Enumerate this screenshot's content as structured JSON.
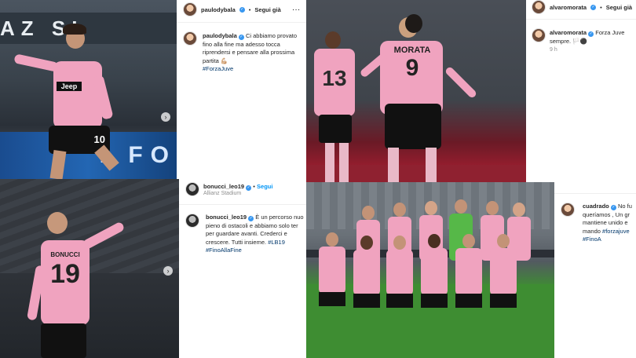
{
  "posts": [
    {
      "username": "paulodybala",
      "follow_label": "Segui già",
      "caption": "Ci abbiamo provato fino alla fine ma adesso tocca riprendersi e pensare alla prossima partita 💪🏼",
      "hashtag": "#ForzaJuve",
      "photo": {
        "sponsor": "Jeep",
        "number": "10",
        "banner": "AZ  SI",
        "footer": "I  FO"
      }
    },
    {
      "username": "alvaromorata",
      "follow_label": "Segui già",
      "caption": "Forza Juve sempre. 🏳️⚫",
      "time": "9 h",
      "photo": {
        "name": "MORATA",
        "number_front": "9",
        "number_back": "13"
      }
    },
    {
      "username": "bonucci_leo19",
      "follow_label": "Segui",
      "location": "Allianz Stadium",
      "caption": "È un percorso nuo pieno di ostacoli e abbiamo solo ter per guardare avanti. Crederci e crescere. Tutti insieme.",
      "hashtags": "#LB19 #FinoAllaFine",
      "photo": {
        "name": "BONUCCI",
        "number": "19"
      }
    },
    {
      "username": "cuadrado",
      "caption": "No fu queríamos , Un gr mantiene unido e mando",
      "hashtags": "#forzajuve #FinoA"
    }
  ],
  "icons": [
    "verified-icon",
    "more-icon",
    "next-arrow-icon"
  ],
  "colors": {
    "juve_pink": "#f0a3bf",
    "ig_blue": "#0095f6",
    "verified_blue": "#3897f0",
    "pitch_green": "#3e8d32"
  }
}
